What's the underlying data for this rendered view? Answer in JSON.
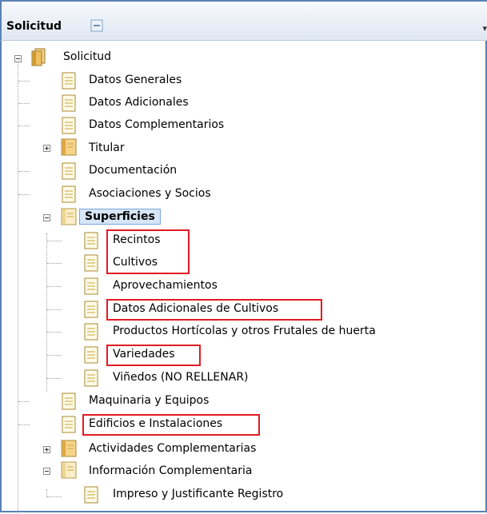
{
  "panel": {
    "title": "Solicitud"
  },
  "tree": {
    "root": "Solicitud",
    "items": [
      "Datos Generales",
      "Datos Adicionales",
      "Datos Complementarios",
      "Titular",
      "Documentación",
      "Asociaciones y Socios",
      "Superficies",
      "Recintos",
      "Cultivos",
      "Aprovechamientos",
      "Datos Adicionales de Cultivos",
      "Productos Hortícolas y otros Frutales de huerta",
      "Variedades",
      "Viñedos (NO RELLENAR)",
      "Maquinaria y Equipos",
      "Edificios e Instalaciones",
      "Actividades Complementarias",
      "Información Complementaria",
      "Impreso y Justificante Registro"
    ]
  },
  "icons": {
    "doc": "document-icon",
    "folder": "folder-icon"
  },
  "colors": {
    "highlight": "#e11b22",
    "selection": "#d7e6f7",
    "border": "#5a82b4"
  }
}
